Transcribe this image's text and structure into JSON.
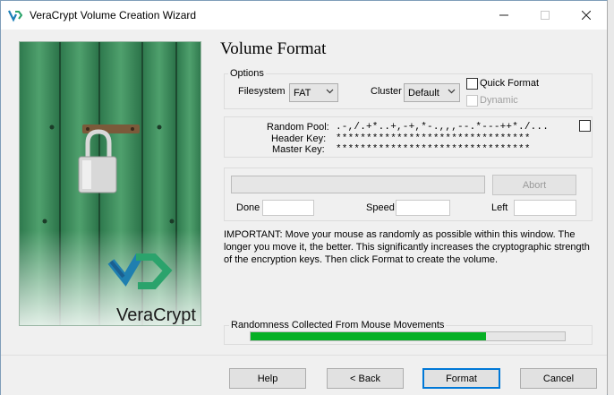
{
  "window": {
    "title": "VeraCrypt Volume Creation Wizard"
  },
  "page": {
    "title": "Volume Format"
  },
  "options": {
    "legend": "Options",
    "filesystem_label": "Filesystem",
    "filesystem_value": "FAT",
    "cluster_label": "Cluster",
    "cluster_value": "Default",
    "quick_format_label": "Quick Format",
    "dynamic_label": "Dynamic"
  },
  "keys": {
    "random_pool_label": "Random Pool:",
    "random_pool_value": ".-,/.+*..+,-+,*-.,,,--.*---++*./...",
    "header_key_label": "Header Key:",
    "header_key_value": "********************************",
    "master_key_label": "Master Key:",
    "master_key_value": "********************************"
  },
  "progress": {
    "abort_label": "Abort",
    "done_label": "Done",
    "speed_label": "Speed",
    "left_label": "Left"
  },
  "important_note": "IMPORTANT: Move your mouse as randomly as possible within this window. The longer you move it, the better. This significantly increases the cryptographic strength of the encryption keys. Then click Format to create the volume.",
  "randomness": {
    "label": "Randomness Collected From Mouse Movements",
    "level": 0.75
  },
  "buttons": {
    "help": "Help",
    "back": "< Back",
    "format": "Format",
    "cancel": "Cancel"
  },
  "brand": {
    "logo_text": "VeraCrypt"
  },
  "colors": {
    "accent": "#0078d7",
    "progress_green": "#06b025"
  }
}
